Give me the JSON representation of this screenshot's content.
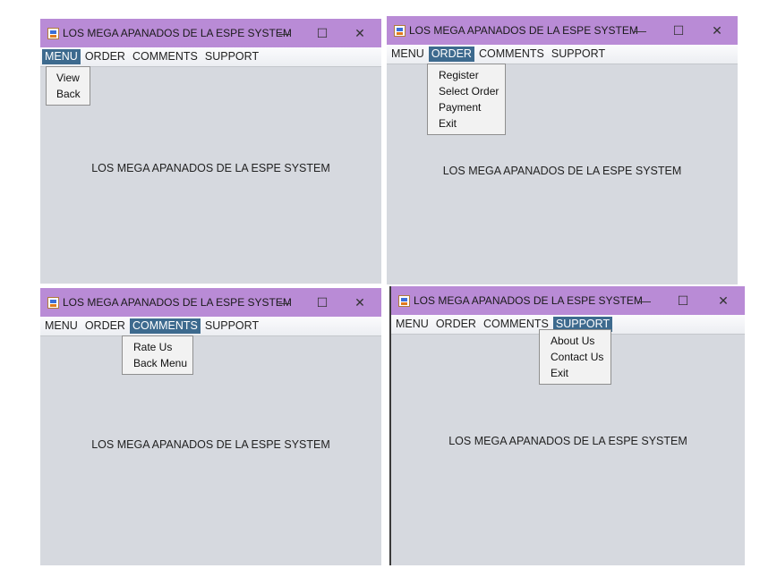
{
  "window_title": "LOS MEGA APANADOS DE LA ESPE SYSTEM",
  "window_controls": {
    "minimize": "—",
    "maximize": "☐",
    "close": "✕"
  },
  "menus": {
    "menu": "MENU",
    "order": "ORDER",
    "comments": "COMMENTS",
    "support": "SUPPORT"
  },
  "menu_items": {
    "menu": [
      "View",
      "Back"
    ],
    "order": [
      "Register",
      "Select Order",
      "Payment",
      "Exit"
    ],
    "comments": [
      "Rate Us",
      "Back Menu"
    ],
    "support": [
      "About Us",
      "Contact Us",
      "Exit"
    ]
  },
  "center_label": "LOS MEGA APANADOS DE LA ESPE SYSTEM",
  "colors": {
    "titlebar": "#b98bd6",
    "menu_highlight": "#3d6a8e",
    "content_bg": "#d6d9df"
  }
}
